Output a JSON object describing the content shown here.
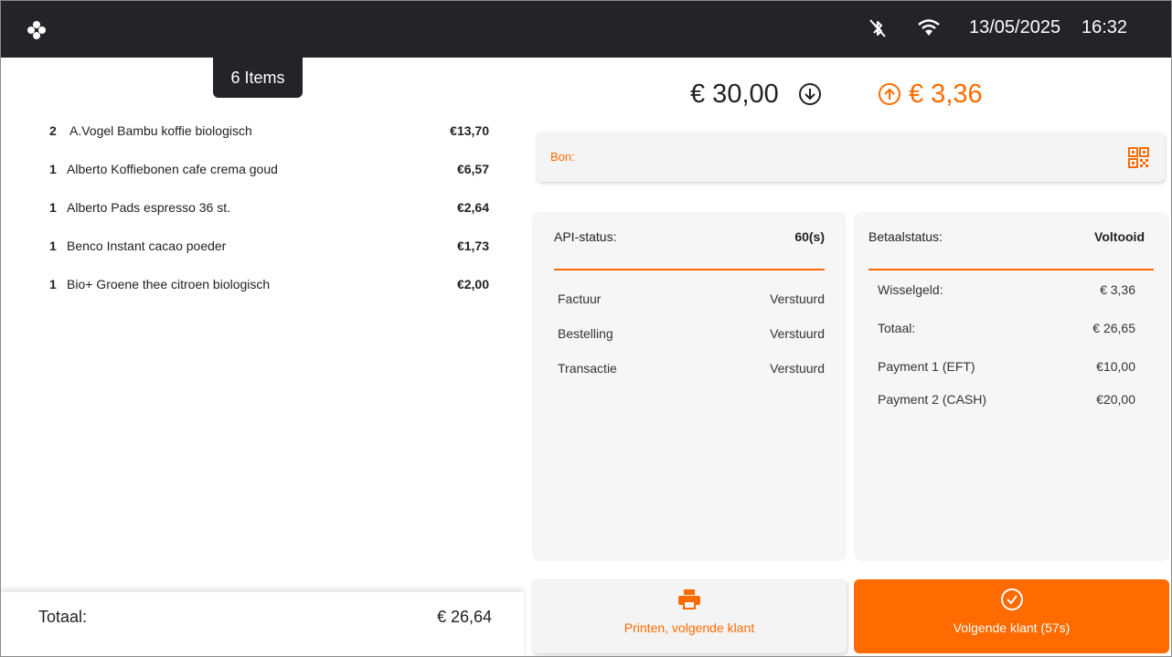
{
  "status_bar": {
    "date": "13/05/2025",
    "time": "16:32",
    "icons": [
      "flower-logo-icon",
      "bluetooth-off-icon",
      "wifi-icon"
    ]
  },
  "cart": {
    "items_badge": "6 Items",
    "items": [
      {
        "qty": "2",
        "name": "A.Vogel Bambu koffie biologisch",
        "price": "€13,70"
      },
      {
        "qty": "1",
        "name": "Alberto Koffiebonen cafe crema goud",
        "price": "€6,57"
      },
      {
        "qty": "1",
        "name": "Alberto Pads espresso 36 st.",
        "price": "€2,64"
      },
      {
        "qty": "1",
        "name": "Benco Instant cacao poeder",
        "price": "€1,73"
      },
      {
        "qty": "1",
        "name": "Bio+ Groene thee citroen biologisch",
        "price": "€2,00"
      }
    ],
    "total_label": "Totaal:",
    "total_value": "€ 26,64"
  },
  "summary": {
    "paid_amount": "€ 30,00",
    "change_amount": "€ 3,36"
  },
  "bon": {
    "label": "Bon:"
  },
  "api_panel": {
    "label": "API-status:",
    "value": "60(s)",
    "rows": [
      {
        "label": "Factuur",
        "value": "Verstuurd"
      },
      {
        "label": "Bestelling",
        "value": "Verstuurd"
      },
      {
        "label": "Transactie",
        "value": "Verstuurd"
      }
    ]
  },
  "payment_panel": {
    "label": "Betaalstatus:",
    "value": "Voltooid",
    "rows": [
      {
        "label": "Wisselgeld:",
        "value": "€ 3,36"
      },
      {
        "label": "Totaal:",
        "value": "€ 26,65"
      },
      {
        "label": "Payment 1 (EFT)",
        "value": "€10,00"
      },
      {
        "label": "Payment 2 (CASH)",
        "value": "€20,00"
      }
    ]
  },
  "actions": {
    "print_label": "Printen, volgende klant",
    "next_label": "Volgende klant (57s)"
  },
  "colors": {
    "accent": "#ff6b00",
    "topbar": "#222427",
    "panel_bg": "#f6f6f6"
  }
}
